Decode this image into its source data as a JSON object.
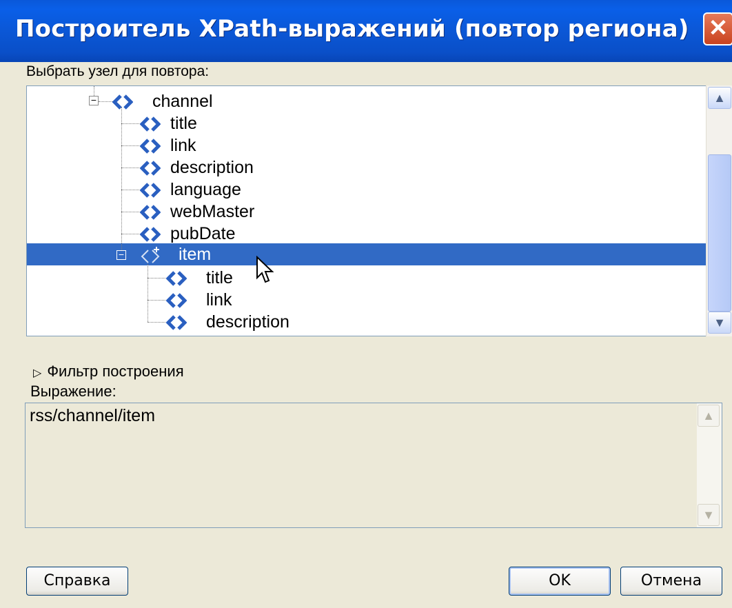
{
  "window": {
    "title": "Построитель XPath-выражений (повтор региона)",
    "close_glyph": "✕"
  },
  "select_label": "Выбрать узел для повтора:",
  "tree": {
    "nodes": [
      {
        "label": "channel",
        "icon": "xml-element-icon"
      },
      {
        "label": "title",
        "icon": "xml-element-icon"
      },
      {
        "label": "link",
        "icon": "xml-element-icon"
      },
      {
        "label": "description",
        "icon": "xml-element-icon"
      },
      {
        "label": "language",
        "icon": "xml-element-icon"
      },
      {
        "label": "webMaster",
        "icon": "xml-element-icon"
      },
      {
        "label": "pubDate",
        "icon": "xml-element-icon"
      },
      {
        "label": "item",
        "icon": "repeat-element-icon",
        "selected": true
      },
      {
        "label": "title",
        "icon": "xml-element-icon"
      },
      {
        "label": "link",
        "icon": "xml-element-icon"
      },
      {
        "label": "description",
        "icon": "xml-element-icon"
      }
    ]
  },
  "filter_label": "Фильтр построения",
  "expression_label": "Выражение:",
  "expression_value": "rss/channel/item",
  "buttons": {
    "help": "Справка",
    "ok": "OK",
    "cancel": "Отмена"
  },
  "colors": {
    "titlebar": "#0a58d9",
    "selection": "#316ac5",
    "dialog_bg": "#ece9d8"
  }
}
